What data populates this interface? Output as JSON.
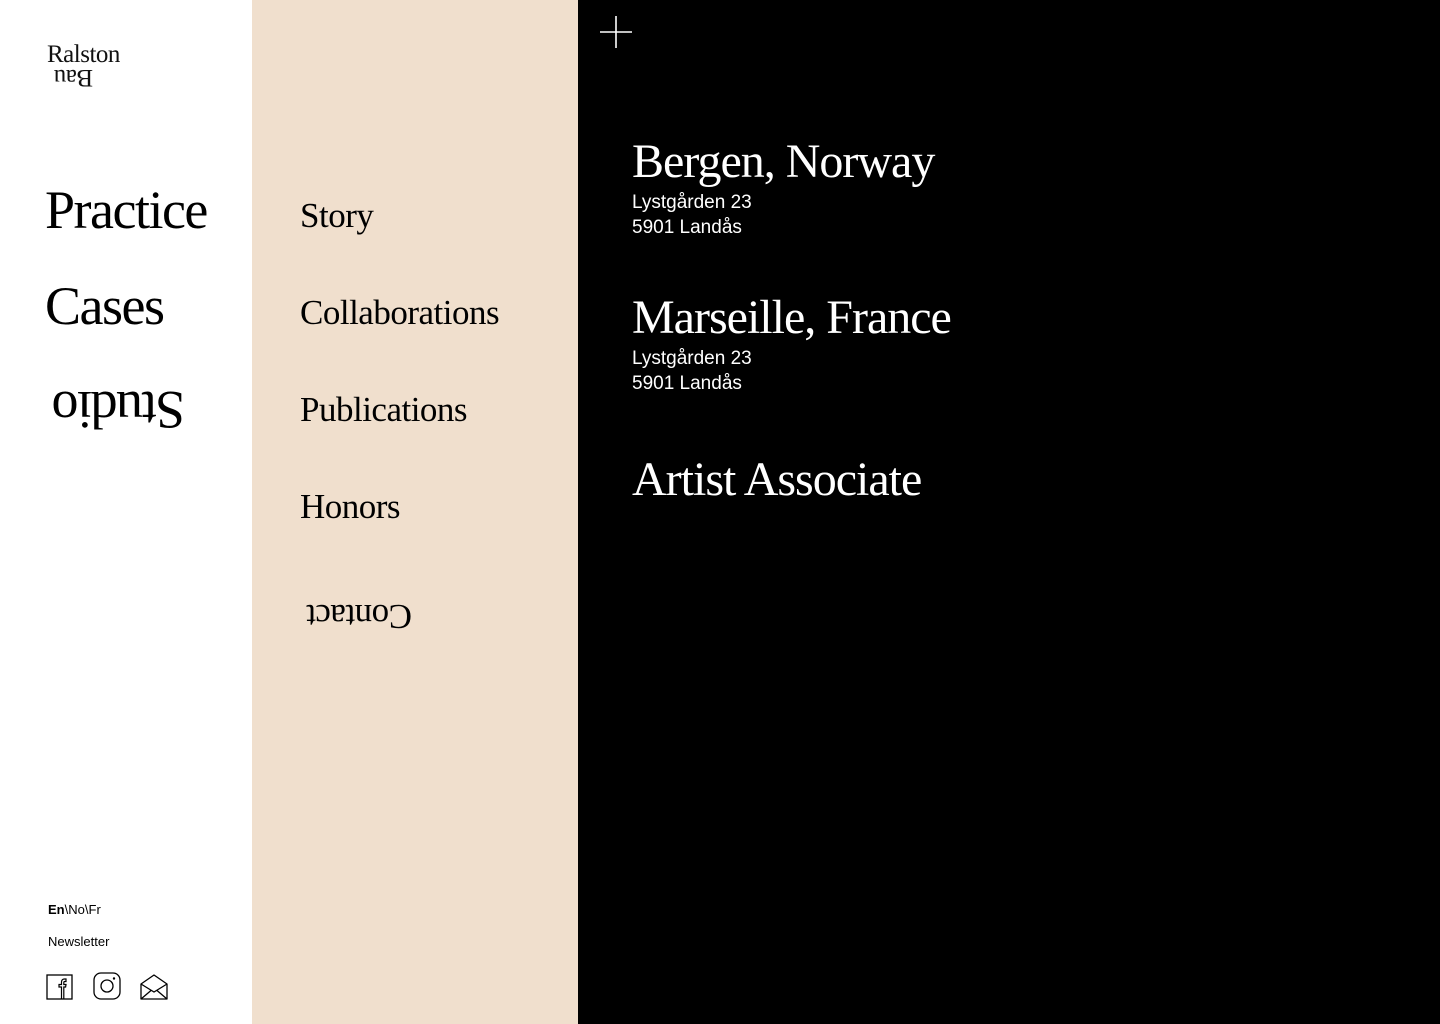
{
  "brand": {
    "line1": "Ralston",
    "line2": "Bau"
  },
  "primary_nav": [
    {
      "label": "Practice"
    },
    {
      "label": "Cases"
    },
    {
      "label": "Studio"
    }
  ],
  "sub_nav": [
    {
      "label": "Story"
    },
    {
      "label": "Collaborations"
    },
    {
      "label": "Publications"
    },
    {
      "label": "Honors"
    },
    {
      "label": "Contact"
    }
  ],
  "language": {
    "active": "En",
    "separator1": "\\",
    "option2": "No",
    "separator2": "\\",
    "option3": "Fr"
  },
  "newsletter_label": "Newsletter",
  "socials": [
    {
      "icon": "facebook-icon"
    },
    {
      "icon": "instagram-icon"
    },
    {
      "icon": "mail-icon"
    }
  ],
  "locations": [
    {
      "title": "Bergen, Norway",
      "street": "Lystgården 23",
      "postal": "5901 Landås"
    },
    {
      "title": "Marseille, France",
      "street": "Lystgården 23",
      "postal": "5901 Landås"
    }
  ],
  "associate_title": "Artist Associate",
  "colors": {
    "left_bg": "#ffffff",
    "middle_bg": "#f0dfcd",
    "right_bg": "#000000",
    "text_dark": "#000000",
    "text_light": "#ffffff"
  }
}
